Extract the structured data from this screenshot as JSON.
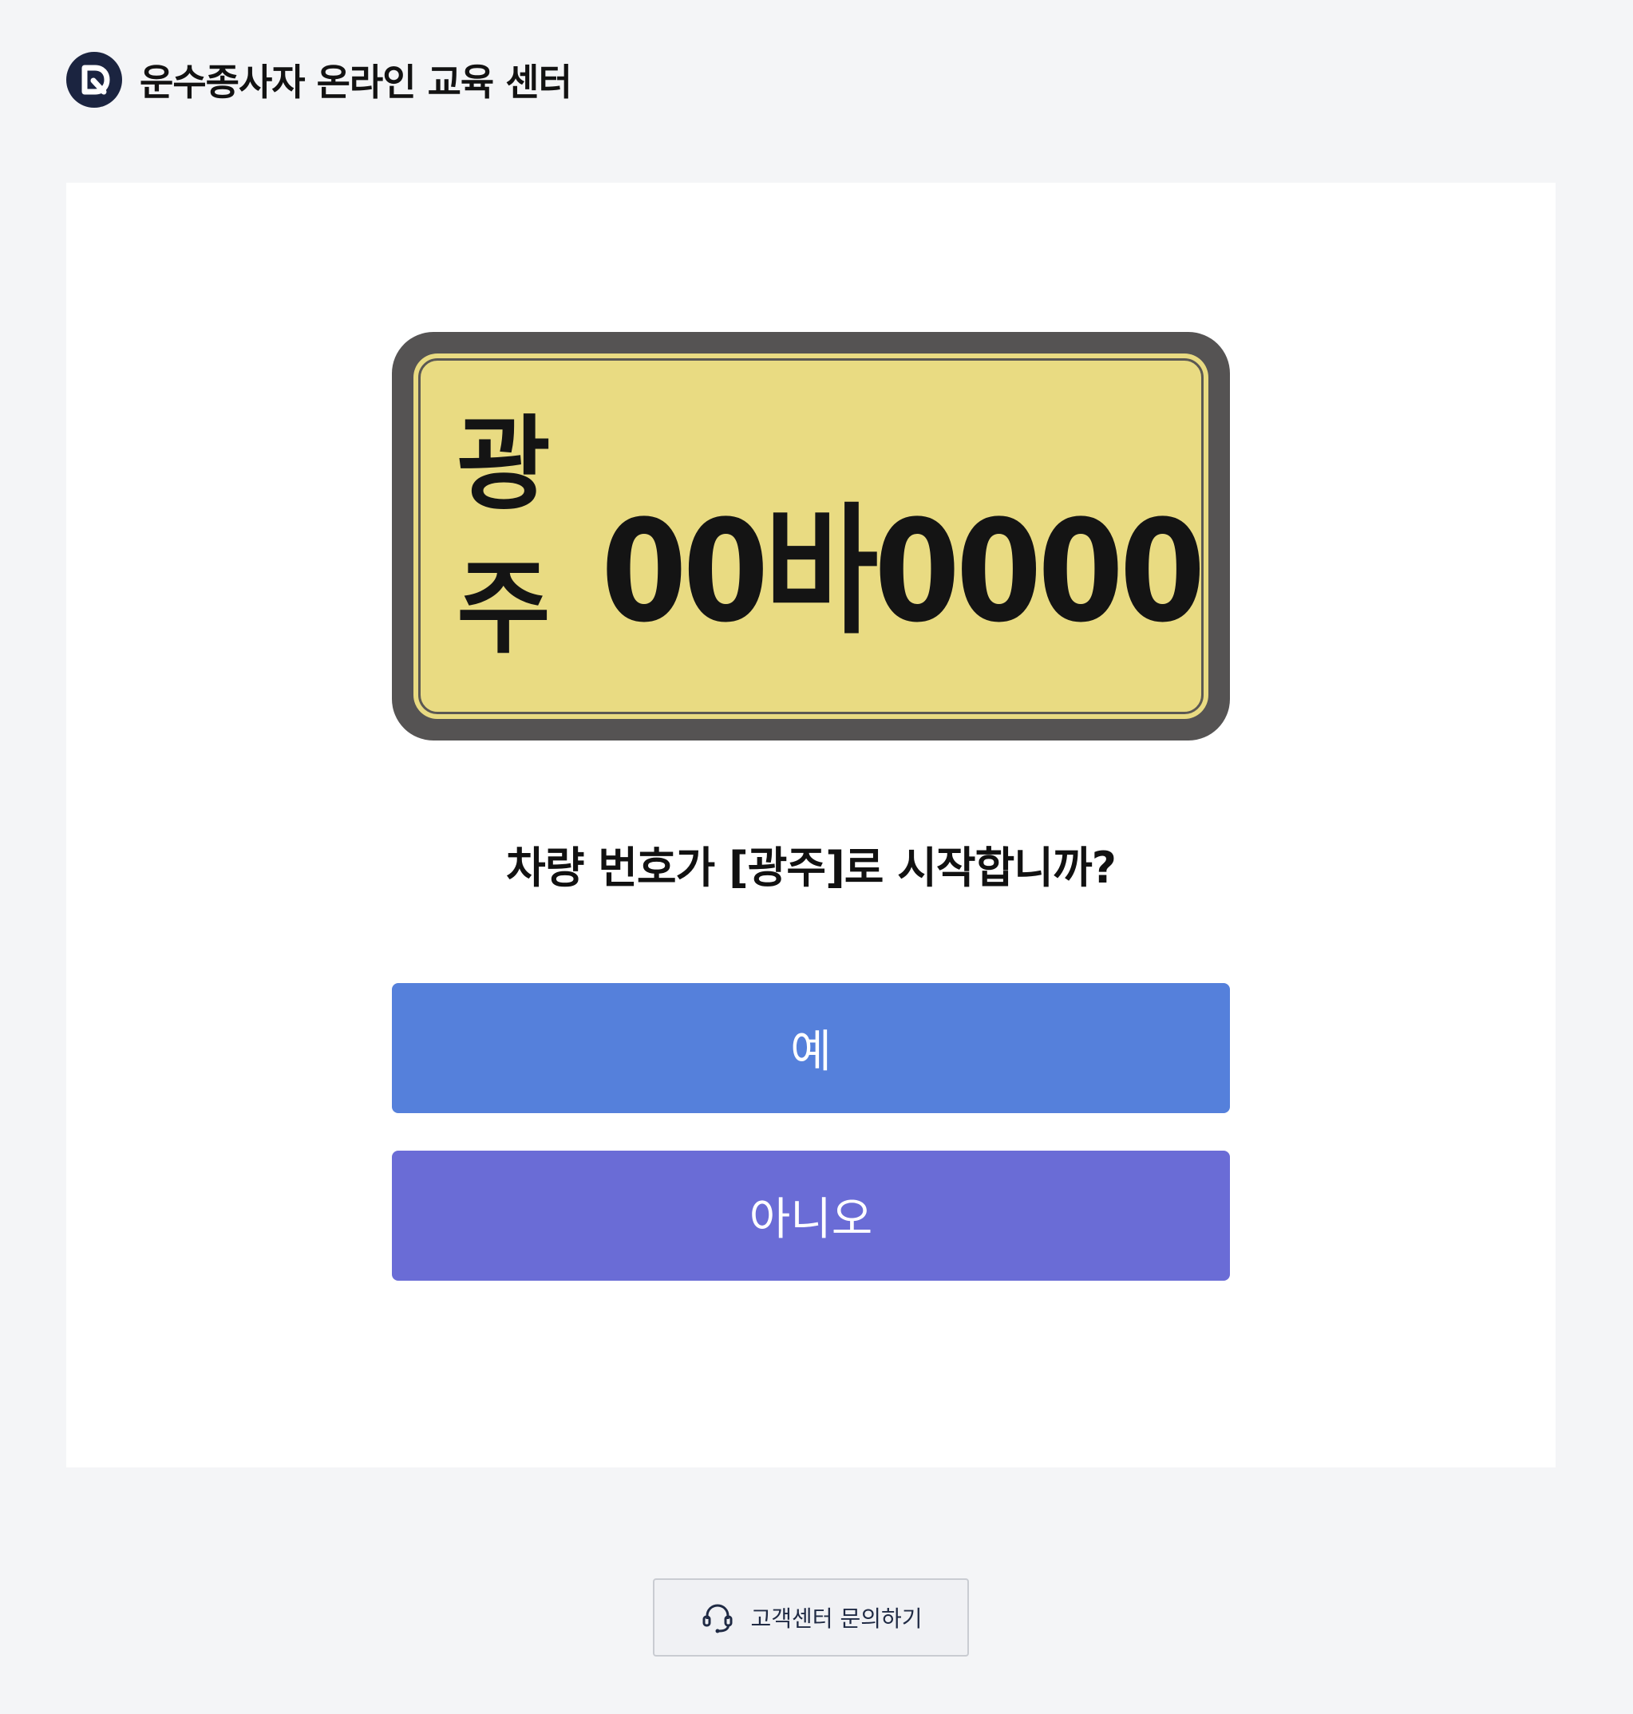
{
  "header": {
    "logo_icon": "d-logo-icon",
    "title": "운수종사자 온라인 교육 센터"
  },
  "plate": {
    "region": "광주",
    "number": "00바0000",
    "colors": {
      "frame": "#555353",
      "face": "#e9db82",
      "text": "#141414"
    }
  },
  "question": "차량 번호가 [광주]로 시작합니까?",
  "buttons": {
    "yes_label": "예",
    "no_label": "아니오",
    "yes_color": "#5580db",
    "no_color": "#6a6cd6"
  },
  "support": {
    "icon": "headset-icon",
    "label": "고객센터 문의하기"
  }
}
